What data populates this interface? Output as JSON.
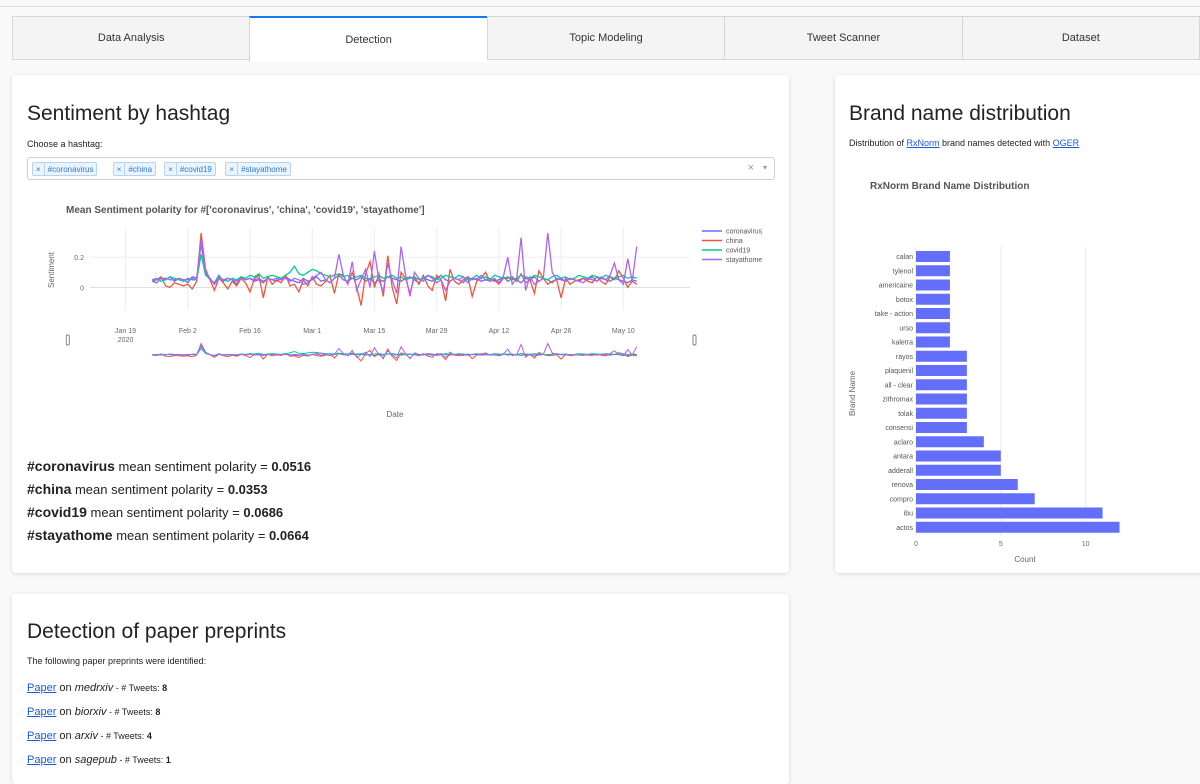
{
  "tabs": [
    "Data Analysis",
    "Detection",
    "Topic Modeling",
    "Tweet Scanner",
    "Dataset"
  ],
  "active_tab": 1,
  "sentiment": {
    "title": "Sentiment by hashtag",
    "choose_label": "Choose a hashtag:",
    "chips": [
      "#coronavirus",
      "#china",
      "#covid19",
      "#stayathome"
    ],
    "clear_glyph": "×",
    "arrow_glyph": "▾",
    "stats": [
      {
        "hashtag": "#coronavirus",
        "label": " mean sentiment polarity = ",
        "value": "0.0516"
      },
      {
        "hashtag": "#china",
        "label": " mean sentiment polarity = ",
        "value": "0.0353"
      },
      {
        "hashtag": "#covid19",
        "label": " mean sentiment polarity = ",
        "value": "0.0686"
      },
      {
        "hashtag": "#stayathome",
        "label": " mean sentiment polarity = ",
        "value": "0.0664"
      }
    ]
  },
  "brand": {
    "title": "Brand name distribution",
    "desc_prefix": "Distribution of ",
    "link1": "RxNorm",
    "desc_middle": " brand names detected with ",
    "link2": "OGER"
  },
  "preprints": {
    "title": "Detection of paper preprints",
    "intro": "The following paper preprints were identified:",
    "items": [
      {
        "link": "Paper",
        "on": " on ",
        "source": "medrxiv",
        "sep": " - # Tweets: ",
        "count": "8"
      },
      {
        "link": "Paper",
        "on": " on ",
        "source": "biorxiv",
        "sep": " - # Tweets: ",
        "count": "8"
      },
      {
        "link": "Paper",
        "on": " on ",
        "source": "arxiv",
        "sep": " - # Tweets: ",
        "count": "4"
      },
      {
        "link": "Paper",
        "on": " on ",
        "source": "sagepub",
        "sep": " - # Tweets: ",
        "count": "1"
      }
    ]
  },
  "chart_data": [
    {
      "type": "line",
      "title": "Mean Sentiment polarity for #['coronavirus', 'china', 'covid19', 'stayathome']",
      "xlabel": "Date",
      "ylabel": "Sentiment",
      "x_start": "2020-01-25",
      "x_step_days": 1,
      "x_ticks": [
        "Jan 19\n2020",
        "Feb 2",
        "Feb 16",
        "Mar 1",
        "Mar 15",
        "Mar 29",
        "Apr 12",
        "Apr 26",
        "May 10"
      ],
      "xlim": [
        "2020-01-11",
        "2020-05-25"
      ],
      "y_ticks": [
        "0",
        "0.2"
      ],
      "ylim": [
        -0.15,
        0.4
      ],
      "legend_position": "right",
      "rangeslider": true,
      "series": [
        {
          "name": "coronavirus",
          "color": "#636efa",
          "values": [
            0.04,
            0.03,
            0.06,
            0.05,
            0.07,
            0.04,
            0.06,
            0.05,
            0.03,
            0.07,
            0.06,
            0.29,
            0.09,
            0.05,
            0.03,
            0.08,
            0.04,
            0.06,
            0.05,
            0.02,
            0.07,
            0.05,
            0.06,
            0.04,
            0.05,
            0.03,
            0.06,
            0.05,
            0.04,
            0.06,
            0.07,
            0.05,
            0.04,
            0.03,
            0.06,
            0.04,
            0.05,
            0.07,
            0.04,
            0.05,
            0.03,
            0.06,
            0.08,
            0.05,
            0.04,
            0.06,
            0.05,
            0.07,
            0.04,
            0.06,
            0.03,
            0.05,
            0.04,
            0.07,
            0.06,
            0.05,
            0.04,
            0.06,
            0.07,
            0.05,
            0.03,
            0.06,
            0.05,
            0.04,
            0.06,
            0.08,
            0.05,
            0.04,
            0.06,
            0.05,
            0.03,
            0.07,
            0.05,
            0.06,
            0.04,
            0.05,
            0.06,
            0.04,
            0.05,
            0.07,
            0.04,
            0.06,
            0.05,
            0.03,
            0.06,
            0.05,
            0.07,
            0.04,
            0.06,
            0.05,
            0.03,
            0.06,
            0.05,
            0.04,
            0.06,
            0.05,
            0.04,
            0.06,
            0.05,
            0.07,
            0.04,
            0.06,
            0.05,
            0.04,
            0.06,
            0.05,
            0.04,
            0.03,
            0.05,
            0.04
          ]
        },
        {
          "name": "china",
          "color": "#ef553b",
          "values": [
            0.04,
            0.05,
            0.07,
            0.01,
            0.0,
            0.03,
            0.02,
            0.01,
            0.02,
            -0.01,
            0.04,
            0.36,
            0.12,
            0.05,
            -0.02,
            0.06,
            0.03,
            -0.01,
            0.04,
            0.01,
            0.06,
            0.03,
            -0.03,
            0.06,
            0.08,
            -0.07,
            0.07,
            0.02,
            0.05,
            0.03,
            0.08,
            0.01,
            0.02,
            -0.03,
            0.05,
            0.01,
            0.07,
            0.02,
            0.01,
            0.04,
            0.08,
            -0.04,
            0.09,
            0.08,
            0.02,
            0.1,
            0.0,
            -0.12,
            0.09,
            0.17,
            0.0,
            0.09,
            -0.06,
            0.21,
            0.0,
            -0.11,
            0.1,
            0.06,
            -0.04,
            0.07,
            0.02,
            0.08,
            0.01,
            -0.02,
            0.08,
            0.05,
            -0.09,
            0.12,
            0.04,
            0.02,
            0.05,
            0.07,
            -0.06,
            0.04,
            0.06,
            0.1,
            0.04,
            0.05,
            0.02,
            0.06,
            0.06,
            0.07,
            0.04,
            0.09,
            0.03,
            0.05,
            -0.04,
            0.11,
            0.06,
            0.02,
            0.04,
            0.05,
            -0.07,
            0.06,
            0.02,
            0.04,
            0.05,
            0.06,
            0.04,
            0.03,
            0.07,
            0.04,
            0.02,
            0.07,
            0.05,
            0.11,
            0.06,
            0.0,
            0.04,
            0.02
          ]
        },
        {
          "name": "covid19",
          "color": "#00cc96",
          "values": [
            0.05,
            0.06,
            0.04,
            0.05,
            0.07,
            0.06,
            0.05,
            0.04,
            0.06,
            0.05,
            0.05,
            0.22,
            0.08,
            0.06,
            0.02,
            0.07,
            0.05,
            0.04,
            0.06,
            0.05,
            0.07,
            0.06,
            0.08,
            0.07,
            0.09,
            0.06,
            0.07,
            0.08,
            0.07,
            0.06,
            0.08,
            0.1,
            0.14,
            0.09,
            0.08,
            0.1,
            0.12,
            0.11,
            0.09,
            0.08,
            0.07,
            0.08,
            0.09,
            0.07,
            0.08,
            0.06,
            0.07,
            0.08,
            0.06,
            0.05,
            0.07,
            0.08,
            0.06,
            0.07,
            0.08,
            0.06,
            0.07,
            0.05,
            0.06,
            0.07,
            0.05,
            0.06,
            0.08,
            0.07,
            0.05,
            0.06,
            0.08,
            0.07,
            0.06,
            0.08,
            0.07,
            0.05,
            0.06,
            0.08,
            0.06,
            0.07,
            0.05,
            0.08,
            0.07,
            0.06,
            0.07,
            0.05,
            0.06,
            0.08,
            0.07,
            0.06,
            0.08,
            0.07,
            0.06,
            0.05,
            0.07,
            0.08,
            0.06,
            0.07,
            0.05,
            0.06,
            0.08,
            0.07,
            0.06,
            0.08,
            0.07,
            0.06,
            0.08,
            0.07,
            0.06,
            0.07,
            0.08,
            0.06,
            0.07,
            0.06
          ]
        },
        {
          "name": "stayathome",
          "color": "#ab63fa",
          "values": [
            0.05,
            0.05,
            0.06,
            0.06,
            0.05,
            0.05,
            0.06,
            0.05,
            0.05,
            0.06,
            0.05,
            0.32,
            0.1,
            0.06,
            0.02,
            0.06,
            0.05,
            0.06,
            0.05,
            0.04,
            0.06,
            0.05,
            0.06,
            0.05,
            0.06,
            0.04,
            0.06,
            0.05,
            0.06,
            0.05,
            0.06,
            0.04,
            0.06,
            0.05,
            0.02,
            0.03,
            0.06,
            0.08,
            0.1,
            0.05,
            0.03,
            0.06,
            0.22,
            0.08,
            0.02,
            0.17,
            -0.02,
            0.05,
            0.12,
            0.0,
            0.24,
            0.05,
            -0.03,
            0.16,
            0.05,
            -0.04,
            0.27,
            0.08,
            -0.06,
            0.1,
            0.06,
            0.04,
            0.08,
            0.06,
            0.03,
            0.05,
            -0.02,
            0.04,
            0.06,
            0.05,
            0.07,
            0.03,
            0.06,
            0.05,
            0.08,
            0.05,
            0.04,
            0.06,
            0.03,
            0.07,
            0.2,
            0.02,
            0.06,
            0.33,
            -0.02,
            0.07,
            0.02,
            0.04,
            0.06,
            0.36,
            0.1,
            0.05,
            0.06,
            0.04,
            0.06,
            0.05,
            0.04,
            0.03,
            0.06,
            0.05,
            0.04,
            0.07,
            0.05,
            0.08,
            0.16,
            0.05,
            0.02,
            0.19,
            0.04,
            0.27
          ]
        }
      ]
    },
    {
      "type": "bar",
      "orientation": "horizontal",
      "title": "RxNorm Brand Name Distribution",
      "xlabel": "Count",
      "ylabel": "Brand Name",
      "xlim": [
        0,
        12.5
      ],
      "x_ticks": [
        0,
        5,
        10
      ],
      "color": "#636efa",
      "categories": [
        "calan",
        "tylenol",
        "americaine",
        "botox",
        "take - action",
        "urso",
        "kaletra",
        "rayos",
        "plaquenil",
        "all - clear",
        "zithromax",
        "tolak",
        "consensi",
        "aclaro",
        "antara",
        "adderall",
        "renova",
        "compro",
        "ibu",
        "actos"
      ],
      "values": [
        2,
        2,
        2,
        2,
        2,
        2,
        2,
        3,
        3,
        3,
        3,
        3,
        3,
        4,
        5,
        5,
        6,
        7,
        11,
        12
      ]
    }
  ]
}
